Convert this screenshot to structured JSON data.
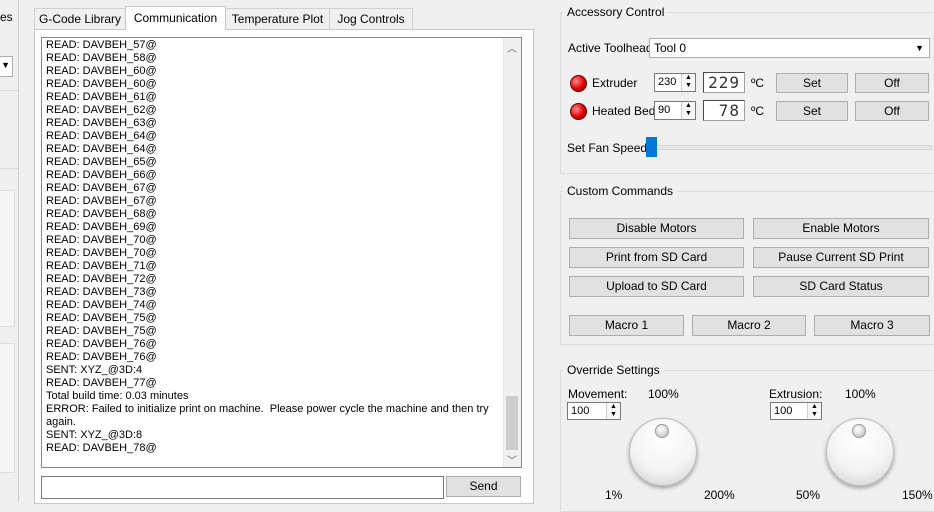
{
  "left_fragment": {
    "text": "es"
  },
  "tabs": [
    {
      "label": "G-Code Library"
    },
    {
      "label": "Communication"
    },
    {
      "label": "Temperature Plot"
    },
    {
      "label": "Jog Controls"
    }
  ],
  "log_lines": [
    "READ: DAVBEH_57@",
    "READ: DAVBEH_58@",
    "READ: DAVBEH_60@",
    "READ: DAVBEH_60@",
    "READ: DAVBEH_61@",
    "READ: DAVBEH_62@",
    "READ: DAVBEH_63@",
    "READ: DAVBEH_64@",
    "READ: DAVBEH_64@",
    "READ: DAVBEH_65@",
    "READ: DAVBEH_66@",
    "READ: DAVBEH_67@",
    "READ: DAVBEH_67@",
    "READ: DAVBEH_68@",
    "READ: DAVBEH_69@",
    "READ: DAVBEH_70@",
    "READ: DAVBEH_70@",
    "READ: DAVBEH_71@",
    "READ: DAVBEH_72@",
    "READ: DAVBEH_73@",
    "READ: DAVBEH_74@",
    "READ: DAVBEH_75@",
    "READ: DAVBEH_75@",
    "READ: DAVBEH_76@",
    "READ: DAVBEH_76@",
    "SENT: XYZ_@3D:4",
    "READ: DAVBEH_77@",
    "Total build time: 0.03 minutes",
    "ERROR: Failed to initialize print on machine.  Please power cycle the machine and then try again.",
    "SENT: XYZ_@3D:8",
    "READ: DAVBEH_78@"
  ],
  "command": {
    "value": "",
    "send_label": "Send"
  },
  "accessory": {
    "title": "Accessory Control",
    "toolhead_label": "Active Toolhead",
    "toolhead_value": "Tool 0",
    "extruder": {
      "label": "Extruder",
      "target": "230",
      "current": "229",
      "unit": "ºC",
      "set_label": "Set",
      "off_label": "Off"
    },
    "bed": {
      "label": "Heated Bed",
      "target": "90",
      "current": "78",
      "unit": "ºC",
      "set_label": "Set",
      "off_label": "Off"
    },
    "fan_label": "Set Fan Speed",
    "fan_value": 0
  },
  "custom": {
    "title": "Custom Commands",
    "disable_motors": "Disable Motors",
    "enable_motors": "Enable Motors",
    "print_sd": "Print from SD Card",
    "pause_sd": "Pause Current SD Print",
    "upload_sd": "Upload to SD Card",
    "sd_status": "SD Card Status",
    "macro1": "Macro 1",
    "macro2": "Macro 2",
    "macro3": "Macro 3"
  },
  "override": {
    "title": "Override Settings",
    "movement": {
      "label": "Movement:",
      "value": "100",
      "percent": "100%",
      "min": "1%",
      "max": "200%"
    },
    "extrusion": {
      "label": "Extrusion:",
      "value": "100",
      "percent": "100%",
      "min": "50%",
      "max": "150%"
    }
  },
  "colors": {
    "accent": "#0078d7",
    "led": "#e00000"
  }
}
